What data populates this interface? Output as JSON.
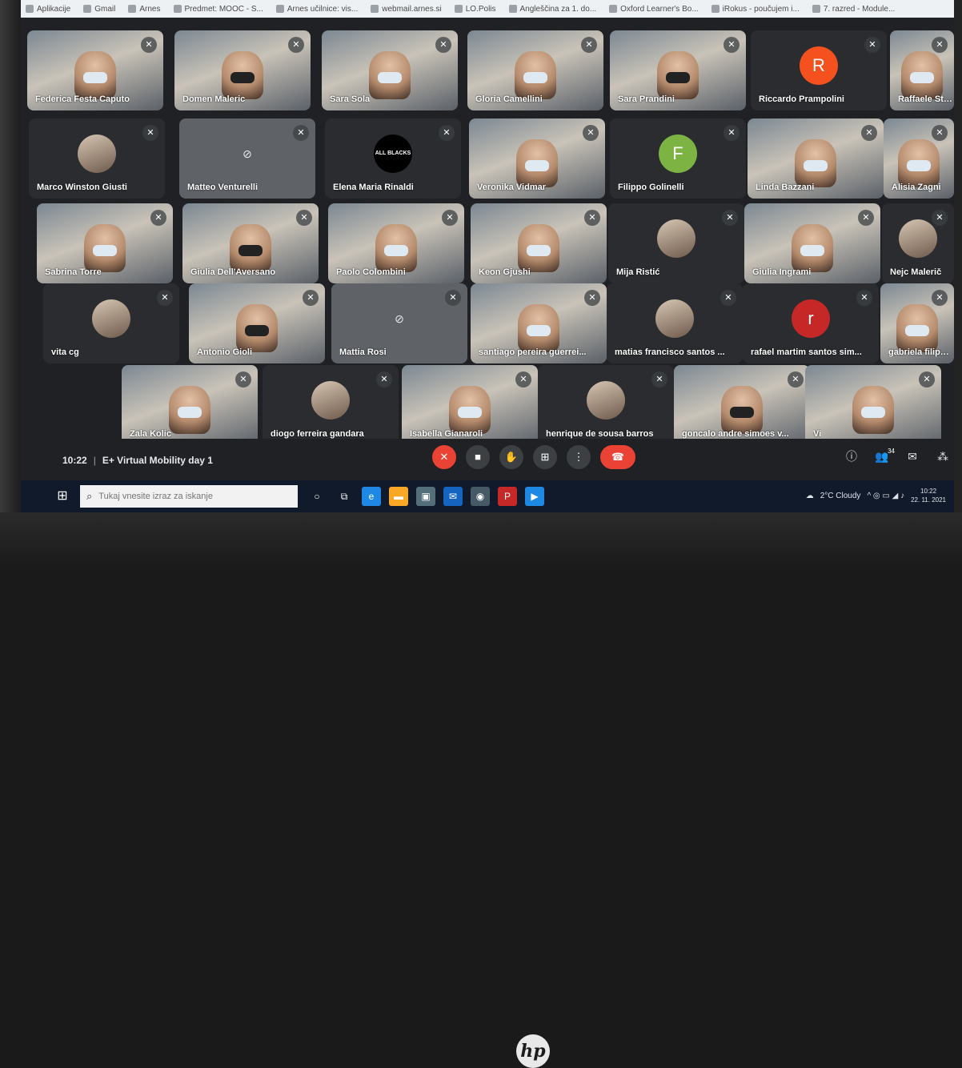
{
  "bookmarks": [
    "Aplikacije",
    "Gmail",
    "Arnes",
    "Predmet: MOOC - S...",
    "Arnes učilnice: vis...",
    "webmail.arnes.si",
    "LO.Polis",
    "Angleščina za 1. do...",
    "Oxford Learner's Bo...",
    "iRokus - poučujem i...",
    "7. razred - Module..."
  ],
  "participants_rows": [
    [
      {
        "name": "Federica Festa Caputo",
        "kind": "video"
      },
      {
        "name": "Domen Maleric",
        "kind": "video"
      },
      {
        "name": "Sara Sola",
        "kind": "video"
      },
      {
        "name": "Gloria Camellini",
        "kind": "video"
      },
      {
        "name": "Sara Prandini",
        "kind": "video"
      },
      {
        "name": "Riccardo Prampolini",
        "kind": "letter",
        "letter": "R",
        "color": "#f4511e"
      },
      {
        "name": "Raffaele Stanzione",
        "kind": "video"
      }
    ],
    [
      {
        "name": "Marco Winston Giusti",
        "kind": "photo"
      },
      {
        "name": "Matteo Venturelli",
        "kind": "camoff"
      },
      {
        "name": "Elena Maria Rinaldi",
        "kind": "logo",
        "logo_text": "ALL BLACKS"
      },
      {
        "name": "Veronika Vidmar",
        "kind": "video"
      },
      {
        "name": "Filippo Golinelli",
        "kind": "letter",
        "letter": "F",
        "color": "#7cb342"
      },
      {
        "name": "Linda Bazzani",
        "kind": "video"
      },
      {
        "name": "Alisia Zagni",
        "kind": "video"
      }
    ],
    [
      {
        "name": "Sabrina Torre",
        "kind": "video"
      },
      {
        "name": "Giulia Dell'Aversano",
        "kind": "video"
      },
      {
        "name": "Paolo Colombini",
        "kind": "video"
      },
      {
        "name": "Keon Gjushi",
        "kind": "video"
      },
      {
        "name": "Mija Ristić",
        "kind": "photo"
      },
      {
        "name": "Giulia Ingrami",
        "kind": "video"
      },
      {
        "name": "Nejc Malerič",
        "kind": "photo"
      }
    ],
    [
      {
        "name": "vita cg",
        "kind": "photo"
      },
      {
        "name": "Antonio Gioli",
        "kind": "video"
      },
      {
        "name": "Mattia Rosi",
        "kind": "camoff"
      },
      {
        "name": "santiago pereira guerrei...",
        "kind": "video"
      },
      {
        "name": "matias francisco santos ...",
        "kind": "photo"
      },
      {
        "name": "rafael martim santos sim...",
        "kind": "letter",
        "letter": "r",
        "color": "#c62828"
      },
      {
        "name": "gabriela filipa de jes...",
        "kind": "video"
      }
    ],
    [
      {
        "name": "Zala Kolic",
        "kind": "video"
      },
      {
        "name": "diogo ferreira gandara",
        "kind": "photo"
      },
      {
        "name": "Isabella Gianaroli",
        "kind": "video"
      },
      {
        "name": "henrique de sousa barros",
        "kind": "photo"
      },
      {
        "name": "goncalo andre simoes v...",
        "kind": "video"
      },
      {
        "name": "Vi",
        "kind": "video"
      }
    ]
  ],
  "meeting": {
    "time": "10:22",
    "title": "E+ Virtual Mobility day 1"
  },
  "controls": [
    "mic-off",
    "camera",
    "raise-hand",
    "present",
    "more",
    "leave"
  ],
  "side_controls": {
    "people_count": "34"
  },
  "taskbar": {
    "search_placeholder": "Tukaj vnesite izraz za iskanje",
    "weather": "2°C Cloudy",
    "clock_time": "10:22",
    "clock_date": "22. 11. 2021"
  },
  "brand": {
    "logo": "hp"
  },
  "colors": {
    "meet_bg": "#202124",
    "tile_bg": "#3c4043",
    "hangup": "#ea4335",
    "taskbar": "#101a2b"
  }
}
